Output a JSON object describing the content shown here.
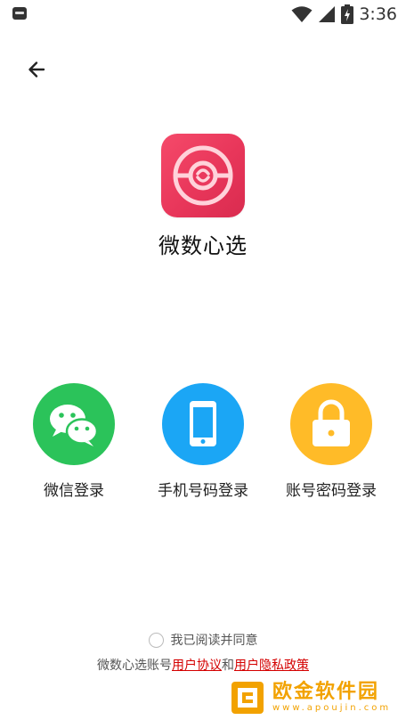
{
  "status_bar": {
    "time": "3:36",
    "icons": [
      "notification-icon",
      "wifi-icon",
      "signal-icon",
      "battery-charging-icon"
    ]
  },
  "header": {
    "back_icon": "arrow-left-icon"
  },
  "app": {
    "name": "微数心选",
    "icon": "app-logo-icon",
    "icon_color": "#ee3d60"
  },
  "login_options": [
    {
      "label": "微信登录",
      "icon": "wechat-icon",
      "color": "#2bc35a"
    },
    {
      "label": "手机号码登录",
      "icon": "phone-icon",
      "color": "#1ba6f5"
    },
    {
      "label": "账号密码登录",
      "icon": "lock-icon",
      "color": "#ffbb28"
    }
  ],
  "agreement": {
    "checkbox_label": "我已阅读并同意",
    "prefix": "微数心选账号",
    "user_agreement": "用户协议",
    "conjunction": "和",
    "privacy_policy": "用户隐私政策",
    "link_color": "#d40000"
  },
  "watermark": {
    "title": "欧金软件园",
    "url": "www.apoujin.com",
    "color": "#f2a200"
  }
}
